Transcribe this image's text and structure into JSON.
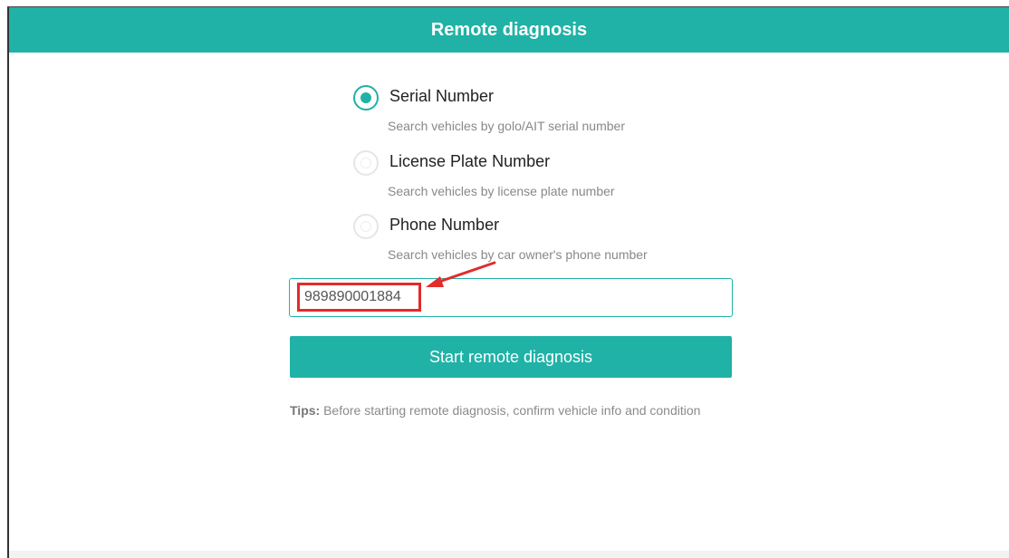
{
  "header": {
    "title": "Remote diagnosis"
  },
  "search_options": [
    {
      "label": "Serial Number",
      "description": "Search vehicles by golo/AIT serial number",
      "selected": true
    },
    {
      "label": "License Plate Number",
      "description": "Search vehicles by license plate number",
      "selected": false
    },
    {
      "label": "Phone Number",
      "description": "Search vehicles by car owner's phone number",
      "selected": false
    }
  ],
  "search_input": {
    "value": "989890001884"
  },
  "start_button": {
    "label": "Start remote diagnosis"
  },
  "tips": {
    "label": "Tips:",
    "text": " Before starting remote diagnosis, confirm vehicle info and condition"
  },
  "colors": {
    "accent": "#20b2a6",
    "annotation": "#e32b2b"
  }
}
